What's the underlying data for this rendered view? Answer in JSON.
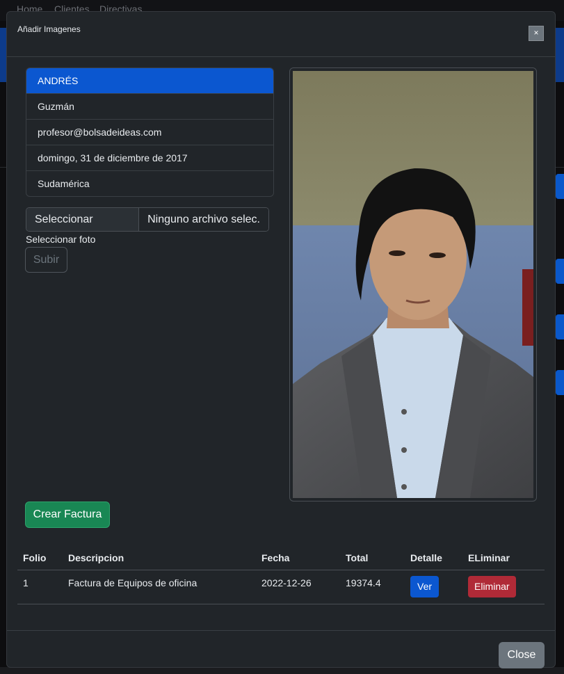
{
  "background": {
    "nav": [
      "Home",
      "Clientes",
      "Directivas"
    ]
  },
  "modal": {
    "title": "Añadir Imagenes",
    "close_x": "×",
    "profile_items": [
      "ANDRÉS",
      "Guzmán",
      "profesor@bolsadeideas.com",
      "domingo, 31 de diciembre de 2017",
      "Sudamérica"
    ],
    "file_input": {
      "button_label": "Seleccionar archivo",
      "status": "Ninguno archivo selec.",
      "label": "Seleccionar foto"
    },
    "upload_button": "Subir",
    "create_invoice_button": "Crear Factura",
    "table": {
      "headers": [
        "Folio",
        "Descripcion",
        "Fecha",
        "Total",
        "Detalle",
        "ELiminar"
      ],
      "rows": [
        {
          "folio": "1",
          "descripcion": "Factura de Equipos de oficina",
          "fecha": "2022-12-26",
          "total": "19374.4",
          "detalle": "Ver",
          "eliminar": "Eliminar"
        }
      ]
    },
    "footer_close": "Close"
  },
  "colors": {
    "primary": "#0b57d0",
    "success": "#198754",
    "danger": "#b02a37",
    "secondary": "#6c757d",
    "modal_bg": "#212529"
  }
}
